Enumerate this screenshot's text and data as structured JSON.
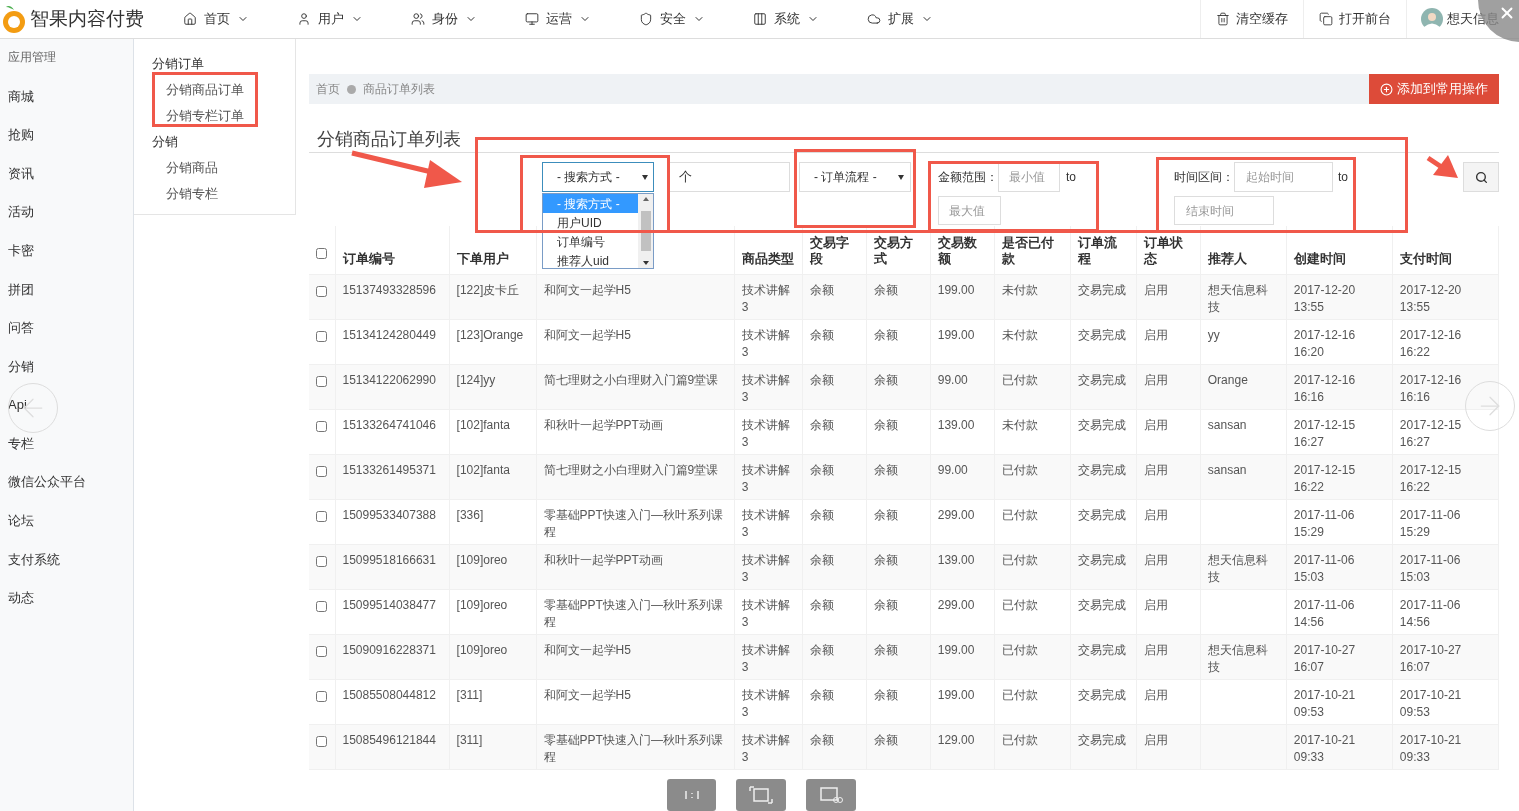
{
  "app": {
    "title": "智果内容付费"
  },
  "nav": [
    {
      "label": "首页"
    },
    {
      "label": "用户"
    },
    {
      "label": "身份"
    },
    {
      "label": "运营"
    },
    {
      "label": "安全"
    },
    {
      "label": "系统"
    },
    {
      "label": "扩展"
    }
  ],
  "header_actions": [
    {
      "label": "清空缓存"
    },
    {
      "label": "打开前台"
    }
  ],
  "user": {
    "name": "想天信息"
  },
  "sidebar": {
    "heading": "应用管理",
    "items": [
      {
        "label": "商城"
      },
      {
        "label": "抢购"
      },
      {
        "label": "资讯"
      },
      {
        "label": "活动"
      },
      {
        "label": "卡密"
      },
      {
        "label": "拼团"
      },
      {
        "label": "问答"
      },
      {
        "label": "分销"
      },
      {
        "label": "Api"
      },
      {
        "label": "专栏"
      },
      {
        "label": "微信公众平台"
      },
      {
        "label": "论坛"
      },
      {
        "label": "支付系统"
      },
      {
        "label": "动态"
      }
    ]
  },
  "subnav": [
    {
      "title": "分销订单",
      "items": [
        {
          "label": "分销商品订单"
        },
        {
          "label": "分销专栏订单"
        }
      ]
    },
    {
      "title": "分销",
      "items": [
        {
          "label": "分销商品"
        },
        {
          "label": "分销专栏"
        }
      ]
    }
  ],
  "breadcrumb": [
    "首页",
    "商品订单列表"
  ],
  "add_button": "添加到常用操作",
  "page_title": "分销商品订单列表",
  "filters": {
    "search_mode": {
      "value": "- 搜索方式 -",
      "options": [
        {
          "label": "- 搜索方式 -",
          "selected": true
        },
        {
          "label": "用户UID",
          "selected": false
        },
        {
          "label": "订单编号",
          "selected": false
        },
        {
          "label": "推荐人uid",
          "selected": false
        }
      ]
    },
    "keyword": {
      "value": "个"
    },
    "order_flow": {
      "value": "- 订单流程 -"
    },
    "amount": {
      "label": "金额范围：",
      "min_placeholder": "最小值",
      "to": "to",
      "max_placeholder": "最大值"
    },
    "time": {
      "label": "时间区间：",
      "start_placeholder": "起始时间",
      "to": "to",
      "end_placeholder": "结束时间"
    }
  },
  "table": {
    "select_all": {
      "checked": false
    },
    "columns": [
      {
        "label": "订单编号"
      },
      {
        "label": "下单用户"
      },
      {},
      {
        "label": "商品类型"
      },
      {
        "label": "交易字段"
      },
      {
        "label": "交易方式"
      },
      {
        "label": "交易数额"
      },
      {
        "label": "是否已付款"
      },
      {
        "label": "订单流程"
      },
      {
        "label": "订单状态"
      },
      {
        "label": "推荐人"
      },
      {
        "label": "创建时间"
      },
      {
        "label": "支付时间"
      }
    ],
    "rows": [
      {
        "checked": false,
        "cells": [
          "15137493328596",
          "[122]皮卡丘",
          "和阿文一起学H5",
          "技术讲解3",
          "余额",
          "余额",
          "199.00",
          "未付款",
          "交易完成",
          "启用",
          "想天信息科技",
          "2017-12-20 13:55",
          "2017-12-20 13:55"
        ]
      },
      {
        "checked": false,
        "cells": [
          "15134124280449",
          "[123]Orange",
          "和阿文一起学H5",
          "技术讲解3",
          "余额",
          "余额",
          "199.00",
          "未付款",
          "交易完成",
          "启用",
          "yy",
          "2017-12-16 16:20",
          "2017-12-16 16:22"
        ]
      },
      {
        "checked": false,
        "cells": [
          "15134122062990",
          "[124]yy",
          "简七理财之小白理财入门篇9堂课",
          "技术讲解3",
          "余额",
          "余额",
          "99.00",
          "已付款",
          "交易完成",
          "启用",
          "Orange",
          "2017-12-16 16:16",
          "2017-12-16 16:16"
        ]
      },
      {
        "checked": false,
        "cells": [
          "15133264741046",
          "[102]fanta",
          "和秋叶一起学PPT动画",
          "技术讲解3",
          "余额",
          "余额",
          "139.00",
          "未付款",
          "交易完成",
          "启用",
          "sansan",
          "2017-12-15 16:27",
          "2017-12-15 16:27"
        ]
      },
      {
        "checked": false,
        "cells": [
          "15133261495371",
          "[102]fanta",
          "简七理财之小白理财入门篇9堂课",
          "技术讲解3",
          "余额",
          "余额",
          "99.00",
          "已付款",
          "交易完成",
          "启用",
          "sansan",
          "2017-12-15 16:22",
          "2017-12-15 16:22"
        ]
      },
      {
        "checked": false,
        "cells": [
          "15099533407388",
          "[336]",
          "零基础PPT快速入门—秋叶系列课程",
          "技术讲解3",
          "余额",
          "余额",
          "299.00",
          "已付款",
          "交易完成",
          "启用",
          null,
          "2017-11-06 15:29",
          "2017-11-06 15:29"
        ]
      },
      {
        "checked": false,
        "cells": [
          "15099518166631",
          "[109]oreo",
          "和秋叶一起学PPT动画",
          "技术讲解3",
          "余额",
          "余额",
          "139.00",
          "已付款",
          "交易完成",
          "启用",
          "想天信息科技",
          "2017-11-06 15:03",
          "2017-11-06 15:03"
        ]
      },
      {
        "checked": false,
        "cells": [
          "15099514038477",
          "[109]oreo",
          "零基础PPT快速入门—秋叶系列课程",
          "技术讲解3",
          "余额",
          "余额",
          "299.00",
          "已付款",
          "交易完成",
          "启用",
          null,
          "2017-11-06 14:56",
          "2017-11-06 14:56"
        ]
      },
      {
        "checked": false,
        "cells": [
          "15090916228371",
          "[109]oreo",
          "和阿文一起学H5",
          "技术讲解3",
          "余额",
          "余额",
          "199.00",
          "已付款",
          "交易完成",
          "启用",
          "想天信息科技",
          "2017-10-27 16:07",
          "2017-10-27 16:07"
        ]
      },
      {
        "checked": false,
        "cells": [
          "15085508044812",
          "[311]",
          "和阿文一起学H5",
          "技术讲解3",
          "余额",
          "余额",
          "199.00",
          "已付款",
          "交易完成",
          "启用",
          null,
          "2017-10-21 09:53",
          "2017-10-21 09:53"
        ]
      },
      {
        "checked": false,
        "cells": [
          "15085496121844",
          "[311]",
          "零基础PPT快速入门—秋叶系列课程",
          "技术讲解3",
          "余额",
          "余额",
          "129.00",
          "已付款",
          "交易完成",
          "启用",
          null,
          "2017-10-21 09:33",
          "2017-10-21 09:33"
        ]
      }
    ]
  }
}
